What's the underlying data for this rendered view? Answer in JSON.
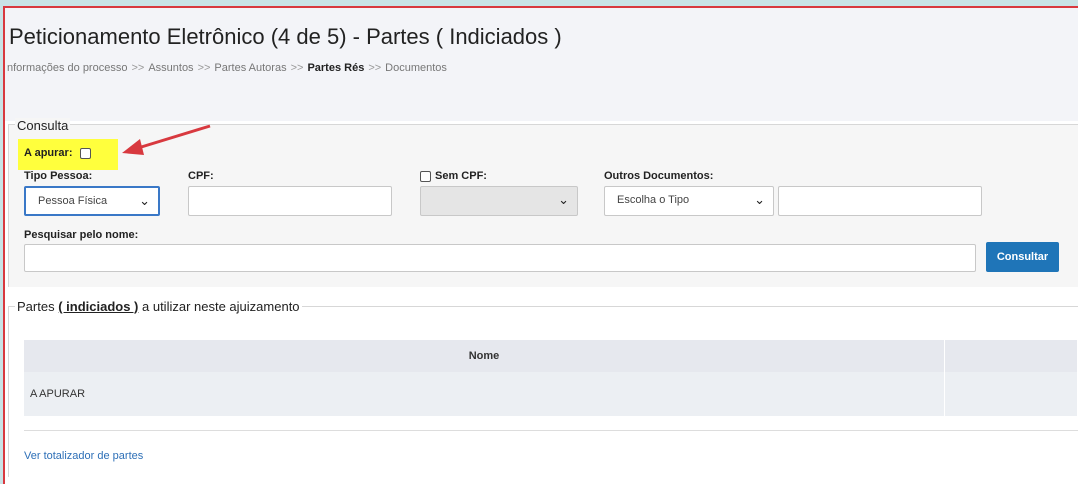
{
  "header": {
    "title": "Peticionamento Eletrônico (4 de 5) - Partes ( Indiciados )",
    "breadcrumb": [
      "nformações do processo",
      "Assuntos",
      "Partes Autoras",
      "Partes Rés",
      "Documentos"
    ],
    "breadcrumb_separator": ">>",
    "active_step": "Partes Rés"
  },
  "consulta": {
    "legend": "Consulta",
    "a_apurar_label": "A apurar:",
    "tipo_pessoa_label": "Tipo Pessoa:",
    "tipo_pessoa_value": "Pessoa Física",
    "cpf_label": "CPF:",
    "cpf_value": "",
    "sem_cpf_label": "Sem CPF:",
    "sem_cpf_select_value": "",
    "outros_documentos_label": "Outros Documentos:",
    "outros_documentos_value": "Escolha o Tipo",
    "outros_documentos_number": "",
    "pesquisar_label": "Pesquisar pelo nome:",
    "pesquisar_value": "",
    "consultar_button": "Consultar"
  },
  "partes": {
    "legend_prefix": "Partes",
    "legend_link": "( indiciados )",
    "legend_suffix": "a utilizar neste ajuizamento",
    "columns": [
      "Nome",
      ""
    ],
    "rows": [
      [
        "A APURAR",
        ""
      ]
    ],
    "totalizador_link": "Ver totalizador de partes"
  },
  "colors": {
    "accent": "#1f75b8",
    "highlight": "#ffff3d",
    "annotation_arrow": "#d8393f",
    "frame_border": "#d8393f"
  }
}
